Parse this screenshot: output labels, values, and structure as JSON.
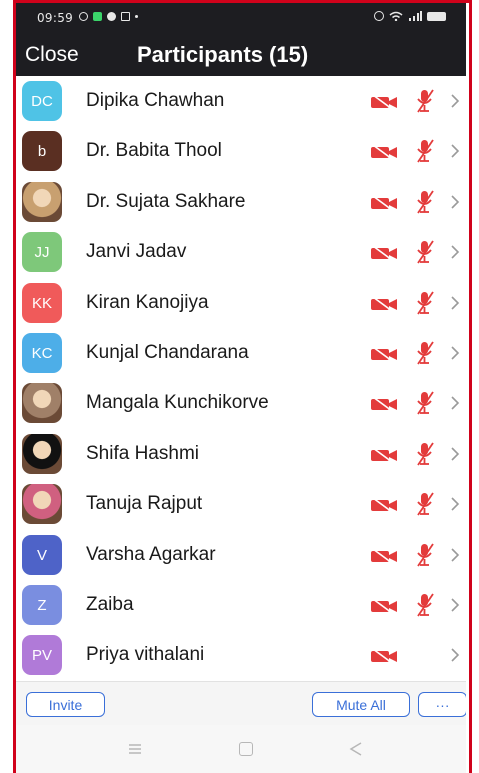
{
  "status_bar": {
    "time": "09:59"
  },
  "header": {
    "close_label": "Close",
    "title": "Participants (15)"
  },
  "participants": [
    {
      "initials": "DC",
      "name": "Dipika Chawhan",
      "color": "#4fc3e6",
      "photo": false,
      "video_muted": true,
      "audio_muted": true
    },
    {
      "initials": "b",
      "name": "Dr. Babita Thool",
      "color": "#5a2f22",
      "photo": false,
      "video_muted": true,
      "audio_muted": true
    },
    {
      "initials": "",
      "name": "Dr. Sujata Sakhare",
      "color": "#c8a070",
      "photo": true,
      "video_muted": true,
      "audio_muted": true
    },
    {
      "initials": "JJ",
      "name": "Janvi Jadav",
      "color": "#7ec87a",
      "photo": false,
      "video_muted": true,
      "audio_muted": true
    },
    {
      "initials": "KK",
      "name": "Kiran Kanojiya",
      "color": "#f05a5a",
      "photo": false,
      "video_muted": true,
      "audio_muted": true
    },
    {
      "initials": "KC",
      "name": "Kunjal Chandarana",
      "color": "#4daee8",
      "photo": false,
      "video_muted": true,
      "audio_muted": true
    },
    {
      "initials": "",
      "name": "Mangala Kunchikorve",
      "color": "#a08068",
      "photo": true,
      "video_muted": true,
      "audio_muted": true
    },
    {
      "initials": "",
      "name": "Shifa Hashmi",
      "color": "#111111",
      "photo": true,
      "video_muted": true,
      "audio_muted": true
    },
    {
      "initials": "",
      "name": "Tanuja Rajput",
      "color": "#d06080",
      "photo": true,
      "video_muted": true,
      "audio_muted": true
    },
    {
      "initials": "V",
      "name": "Varsha Agarkar",
      "color": "#4e63c8",
      "photo": false,
      "video_muted": true,
      "audio_muted": true
    },
    {
      "initials": "Z",
      "name": "Zaiba",
      "color": "#7a8ee0",
      "photo": false,
      "video_muted": true,
      "audio_muted": true
    },
    {
      "initials": "PV",
      "name": "Priya vithalani",
      "color": "#b07ad8",
      "photo": false,
      "video_muted": true,
      "audio_muted": false
    }
  ],
  "footer": {
    "invite_label": "Invite",
    "mute_all_label": "Mute All",
    "more_label": "···"
  },
  "colors": {
    "muted_red": "#e33b3b",
    "accent_blue": "#3a6fd8",
    "header_bg": "#1d1d21"
  }
}
